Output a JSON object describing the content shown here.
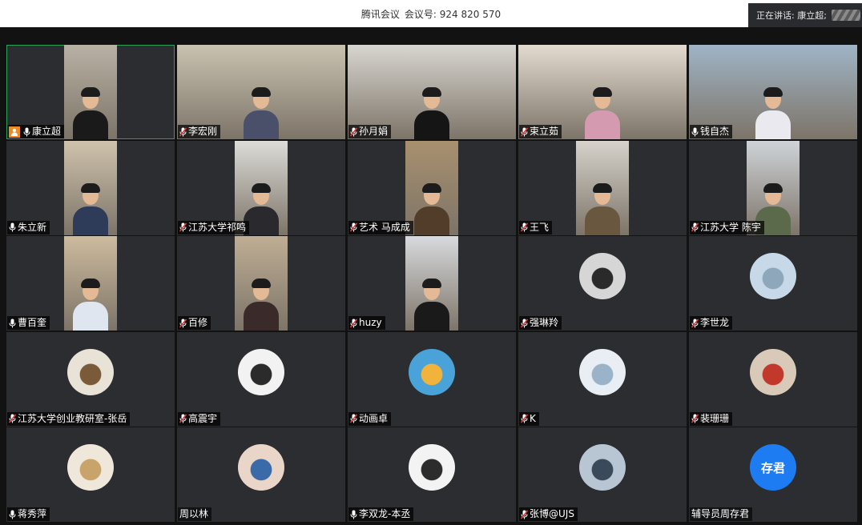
{
  "window": {
    "app_name": "腾讯会议",
    "meeting_label": "会议号: 924 820 570"
  },
  "speaking": {
    "text": "正在讲话: 康立超;"
  },
  "colors": {
    "active_border": "#2fa35a",
    "host_badge": "#f08a24",
    "text_avatar": "#1e7cf2",
    "mic_muted": "#e0393e"
  },
  "participants": [
    {
      "name": "康立超",
      "mic": "on",
      "host": true,
      "kind": "video-narrow",
      "active": true,
      "bg": "#b8b1a4",
      "shirt": "#1a1a1a"
    },
    {
      "name": "李宏刚",
      "mic": "muted",
      "kind": "video-wide",
      "bg": "#c9c2b0",
      "shirt": "#4a4f6a"
    },
    {
      "name": "孙月娟",
      "mic": "muted",
      "kind": "video-wide",
      "bg": "#d8d6d0",
      "shirt": "#151515"
    },
    {
      "name": "束立茹",
      "mic": "muted",
      "kind": "video-wide",
      "bg": "#e4dbd0",
      "shirt": "#d49ab0"
    },
    {
      "name": "钱自杰",
      "mic": "on",
      "kind": "video-wide",
      "bg": "#9fb4c6",
      "shirt": "#e9e9ef"
    },
    {
      "name": "朱立新",
      "mic": "on",
      "kind": "video-narrow",
      "bg": "#cfc3ad",
      "shirt": "#2f3c59"
    },
    {
      "name": "江苏大学祁鸣",
      "mic": "muted",
      "kind": "video-narrow",
      "bg": "#dcdcd8",
      "shirt": "#2a2a2e"
    },
    {
      "name": "艺术 马成成",
      "mic": "muted",
      "kind": "video-narrow",
      "bg": "#a8906f",
      "shirt": "#523c2a"
    },
    {
      "name": "王飞",
      "mic": "muted",
      "kind": "video-narrow",
      "bg": "#d6d3cc",
      "shirt": "#6a5740"
    },
    {
      "name": "江苏大学 陈宇",
      "mic": "muted",
      "kind": "video-narrow",
      "bg": "#cfd3d8",
      "shirt": "#5b6a4a"
    },
    {
      "name": "曹百奎",
      "mic": "on",
      "kind": "video-narrow",
      "bg": "#cdbb9e",
      "shirt": "#dfe6ef"
    },
    {
      "name": "百修",
      "mic": "muted",
      "kind": "video-narrow",
      "bg": "#bfae94",
      "shirt": "#3a2b2a"
    },
    {
      "name": "huzy",
      "mic": "muted",
      "kind": "video-narrow",
      "bg": "#d8dade",
      "shirt": "#1a1a1a"
    },
    {
      "name": "强琳羚",
      "mic": "muted",
      "kind": "avatar",
      "avatar_colors": [
        "#d6d6d6",
        "#2a2a2a"
      ]
    },
    {
      "name": "李世龙",
      "mic": "muted",
      "kind": "avatar",
      "avatar_colors": [
        "#c7d9e8",
        "#8ea7bb"
      ]
    },
    {
      "name": "江苏大学创业教研室-张岳",
      "mic": "muted",
      "kind": "avatar",
      "avatar_colors": [
        "#e9e2d6",
        "#7b5a3a"
      ]
    },
    {
      "name": "高震宇",
      "mic": "muted",
      "kind": "avatar",
      "avatar_colors": [
        "#f2f2f2",
        "#2b2b2b"
      ]
    },
    {
      "name": "动画卓",
      "mic": "muted",
      "kind": "avatar",
      "avatar_colors": [
        "#4aa3d8",
        "#f2b33d"
      ]
    },
    {
      "name": "K",
      "mic": "muted",
      "kind": "avatar",
      "avatar_colors": [
        "#e8eef4",
        "#9bb3c9"
      ]
    },
    {
      "name": "裴珊珊",
      "mic": "muted",
      "kind": "avatar",
      "avatar_colors": [
        "#d9c9b8",
        "#c0392b"
      ]
    },
    {
      "name": "蒋秀萍",
      "mic": "on",
      "kind": "avatar",
      "avatar_colors": [
        "#efe7da",
        "#c9a46a"
      ]
    },
    {
      "name": "周以林",
      "mic": "none",
      "kind": "avatar",
      "avatar_colors": [
        "#e9d6c8",
        "#3a6aa8"
      ]
    },
    {
      "name": "李双龙-本丞",
      "mic": "on",
      "kind": "avatar",
      "avatar_colors": [
        "#f3f3f3",
        "#2c2c2c"
      ]
    },
    {
      "name": "张博@UJS",
      "mic": "muted",
      "kind": "avatar",
      "avatar_colors": [
        "#b8c6d4",
        "#3b4a5a"
      ]
    },
    {
      "name": "辅导员周存君",
      "mic": "none",
      "kind": "avatar-text",
      "avatar_text": "存君"
    }
  ]
}
